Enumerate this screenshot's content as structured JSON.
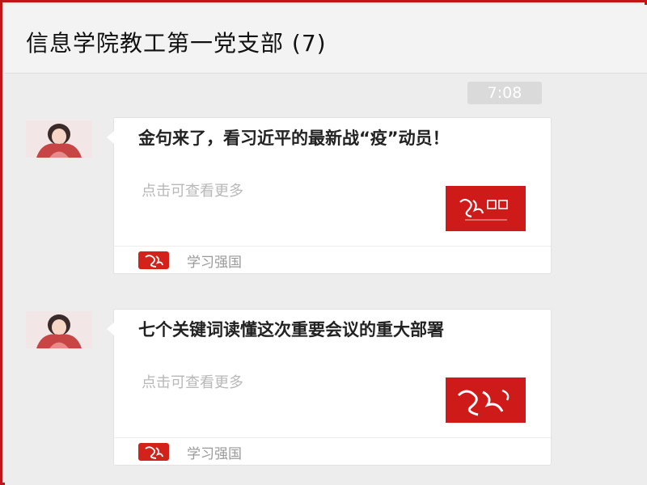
{
  "header": {
    "title": "信息学院教工第一党支部 (7)"
  },
  "chat": {
    "timestamp": "7:08"
  },
  "messages": [
    {
      "title": "金句来了，看习近平的最新战“疫”动员！",
      "subtitle": "点击可查看更多",
      "thumbnail_icon": "xuexi-qiangguo-logo",
      "source": "学习强国"
    },
    {
      "title": "七个关键词读懂这次重要会议的重大部署",
      "subtitle": "点击可查看更多",
      "thumbnail_icon": "xuexi-logo",
      "source": "学习强国"
    }
  ],
  "colors": {
    "frame": "#c0151b",
    "brand_red": "#cf1a1a",
    "background": "#ededed"
  }
}
